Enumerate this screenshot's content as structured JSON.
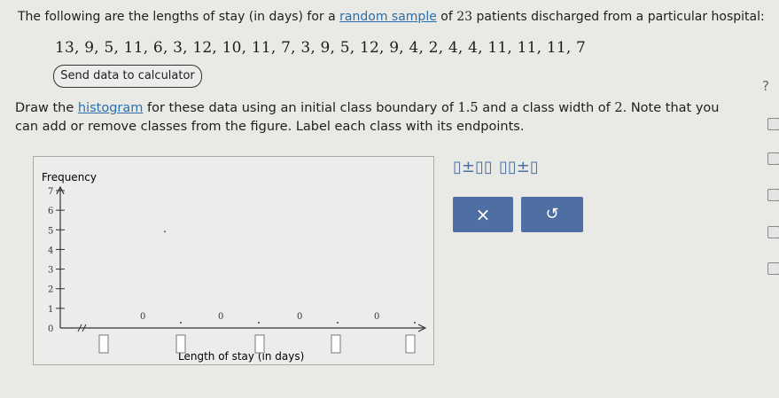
{
  "prompt": {
    "before": "The following are the lengths of stay (in days) for a ",
    "link": "random sample",
    "after_a": " of ",
    "n": "23",
    "after_b": " patients discharged from a particular hospital:"
  },
  "data_list": "13, 9, 5, 11, 6, 3, 12, 10, 11, 7, 3, 9, 5, 12, 9, 4, 2, 4, 4, 11, 11, 11, 7",
  "calc_button": "Send data to calculator",
  "instructions": {
    "a": "Draw the ",
    "link": "histogram",
    "b": " for these data using an initial class boundary of ",
    "boundary": "1.5",
    "c": " and a class width of ",
    "width": "2",
    "d": ". Note that you can add or remove classes from the figure. Label each class with its endpoints."
  },
  "help_icon": "?",
  "chart_data": {
    "type": "bar",
    "ylabel": "Frequency",
    "xlabel": "Length of stay (in days)",
    "ylim": [
      0,
      7
    ],
    "yticks": [
      "0",
      "1",
      "2",
      "3",
      "4",
      "5",
      "6",
      "7"
    ],
    "bar_values": [
      "0",
      "0",
      "0",
      "0"
    ],
    "class_label_boxes": 5
  },
  "tools": {
    "tool1": "▯±▯▯",
    "tool2": "▯▯±▯"
  },
  "buttons": {
    "clear": "×",
    "undo": "↺"
  },
  "colors": {
    "accent": "#4f6ea3",
    "link": "#2a6fb0"
  }
}
